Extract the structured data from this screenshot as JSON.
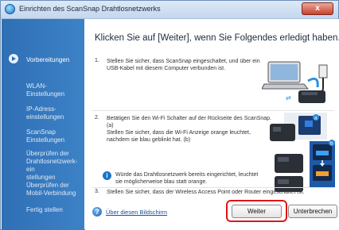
{
  "window": {
    "title": "Einrichten des ScanSnap Drahtlosnetzwerks",
    "close_label": "x"
  },
  "sidebar": {
    "items": [
      {
        "label": "Vorbereitungen",
        "active": true
      },
      {
        "label": "WLAN-\nEinstellungen",
        "active": false
      },
      {
        "label": "IP-Adress-\neinstellungen",
        "active": false
      },
      {
        "label": "ScanSnap\nEinstellungen",
        "active": false
      },
      {
        "label": "Überprüfen der\nDrahtlosnetzwerk-ein\nstellungen",
        "active": false
      },
      {
        "label": "Überprüfen der\nMobil-Verbindung",
        "active": false
      },
      {
        "label": "Fertig stellen",
        "active": false
      }
    ]
  },
  "main": {
    "heading": "Klicken Sie auf [Weiter], wenn Sie Folgendes erledigt haben.",
    "steps": [
      {
        "number": "1.",
        "text": "Stellen Sie sicher, dass ScanSnap eingeschaltet, und über ein\nUSB-Kabel mit diesem Computer verbunden ist."
      },
      {
        "number": "2.",
        "text": "Betätigen Sie den Wi-Fi Schalter auf der Rückseite des ScanSnap.\n(a)\nStellen Sie sicher, dass die Wi-Fi Anzeige orange leuchtet,\nnachdem sie blau geblinkt hat. (b)"
      },
      {
        "number": "3.",
        "text": "Stellen Sie sicher, dass der Wireless Access Point oder Router eingeschaltet ist."
      }
    ],
    "note": "Würde das Drahtlosnetzwerk bereits eingerichtet, leuchtet\nsie möglicherweise blau statt orange.",
    "illustration_labels": {
      "a": "a",
      "b": "b"
    }
  },
  "footer": {
    "help_link": "Über diesen Bildschirm",
    "next_label": "Weiter",
    "cancel_label": "Unterbrechen"
  },
  "colors": {
    "sidebar": "#3d82c6",
    "accent": "#1e73c9",
    "highlight": "#e01515"
  }
}
